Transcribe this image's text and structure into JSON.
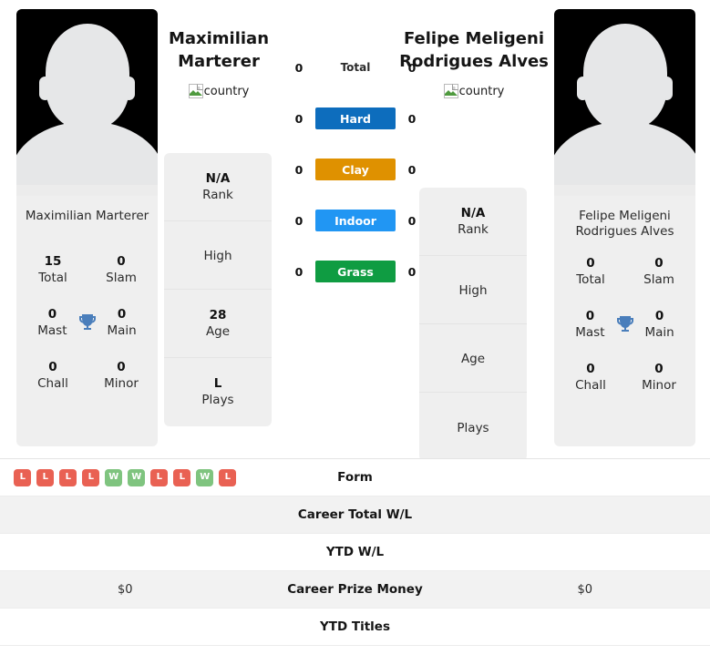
{
  "players": {
    "left": {
      "display_name": "Maximilian Marterer",
      "name_line1": "Maximilian",
      "name_line2": "Marterer",
      "flag_alt": "country",
      "card_name": "Maximilian Marterer",
      "titles": [
        {
          "value": "15",
          "label": "Total"
        },
        {
          "value": "0",
          "label": "Slam"
        },
        {
          "value": "0",
          "label": "Mast"
        },
        {
          "value": "0",
          "label": "Main"
        },
        {
          "value": "0",
          "label": "Chall"
        },
        {
          "value": "0",
          "label": "Minor"
        }
      ],
      "info": [
        {
          "value": "N/A",
          "label": "Rank"
        },
        {
          "value": "",
          "label": "High"
        },
        {
          "value": "28",
          "label": "Age"
        },
        {
          "value": "L",
          "label": "Plays"
        }
      ],
      "surface_counts": {
        "total": "0",
        "hard": "0",
        "clay": "0",
        "indoor": "0",
        "grass": "0"
      },
      "career_total_wl": "",
      "ytd_wl": "",
      "career_prize_money": "$0",
      "ytd_titles": "",
      "form": [
        "L",
        "L",
        "L",
        "L",
        "W",
        "W",
        "L",
        "L",
        "W",
        "L"
      ]
    },
    "right": {
      "display_name": "Felipe Meligeni Rodrigues Alves",
      "name_line1": "Felipe Meligeni",
      "name_line2": "Rodrigues Alves",
      "flag_alt": "country",
      "card_name": "Felipe Meligeni Rodrigues Alves",
      "titles": [
        {
          "value": "0",
          "label": "Total"
        },
        {
          "value": "0",
          "label": "Slam"
        },
        {
          "value": "0",
          "label": "Mast"
        },
        {
          "value": "0",
          "label": "Main"
        },
        {
          "value": "0",
          "label": "Chall"
        },
        {
          "value": "0",
          "label": "Minor"
        }
      ],
      "info": [
        {
          "value": "N/A",
          "label": "Rank"
        },
        {
          "value": "",
          "label": "High"
        },
        {
          "value": "",
          "label": "Age"
        },
        {
          "value": "",
          "label": "Plays"
        }
      ],
      "surface_counts": {
        "total": "0",
        "hard": "0",
        "clay": "0",
        "indoor": "0",
        "grass": "0"
      },
      "career_total_wl": "",
      "ytd_wl": "",
      "career_prize_money": "$0",
      "ytd_titles": "",
      "form": []
    }
  },
  "surfaces": [
    {
      "key": "total",
      "label": "Total",
      "color": "transparent"
    },
    {
      "key": "hard",
      "label": "Hard",
      "color": "#0d6dbd"
    },
    {
      "key": "clay",
      "label": "Clay",
      "color": "#df9100"
    },
    {
      "key": "indoor",
      "label": "Indoor",
      "color": "#2196f3"
    },
    {
      "key": "grass",
      "label": "Grass",
      "color": "#0f9c42"
    }
  ],
  "table_rows": [
    {
      "label": "Form"
    },
    {
      "label": "Career Total W/L"
    },
    {
      "label": "YTD W/L"
    },
    {
      "label": "Career Prize Money"
    },
    {
      "label": "YTD Titles"
    }
  ],
  "colors": {
    "win_badge": "#7fc47f",
    "loss_badge": "#e96153",
    "card_background": "#efefef",
    "row_alt_background": "#f2f2f2",
    "photo_background": "#000000"
  }
}
